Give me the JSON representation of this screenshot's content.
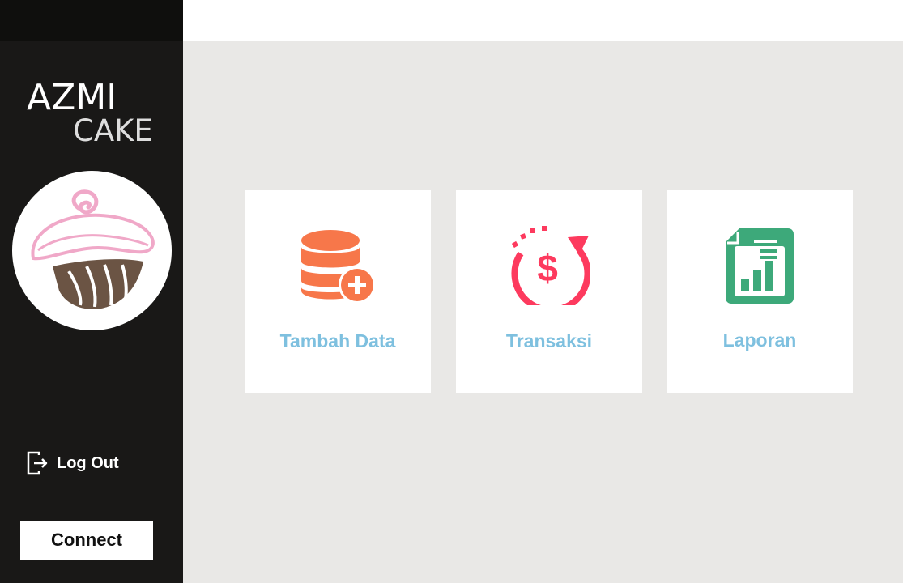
{
  "brand": {
    "line1": "AZMI",
    "line2": "CAKE"
  },
  "sidebar": {
    "logout_label": "Log Out",
    "connect_label": "Connect"
  },
  "menu": {
    "cards": [
      {
        "label": "Tambah Data",
        "icon": "database-add-icon",
        "color": "#f7774a"
      },
      {
        "label": "Transaksi",
        "icon": "dollar-refresh-icon",
        "color": "#fd3a5e"
      },
      {
        "label": "Laporan",
        "icon": "report-chart-icon",
        "color": "#3da97a"
      }
    ],
    "label_color": "#7ec0df"
  },
  "colors": {
    "sidebar_bg": "#191817",
    "content_bg": "#e9e8e6",
    "logo_pink": "#f0a8c8",
    "logo_brown": "#6b5444"
  }
}
